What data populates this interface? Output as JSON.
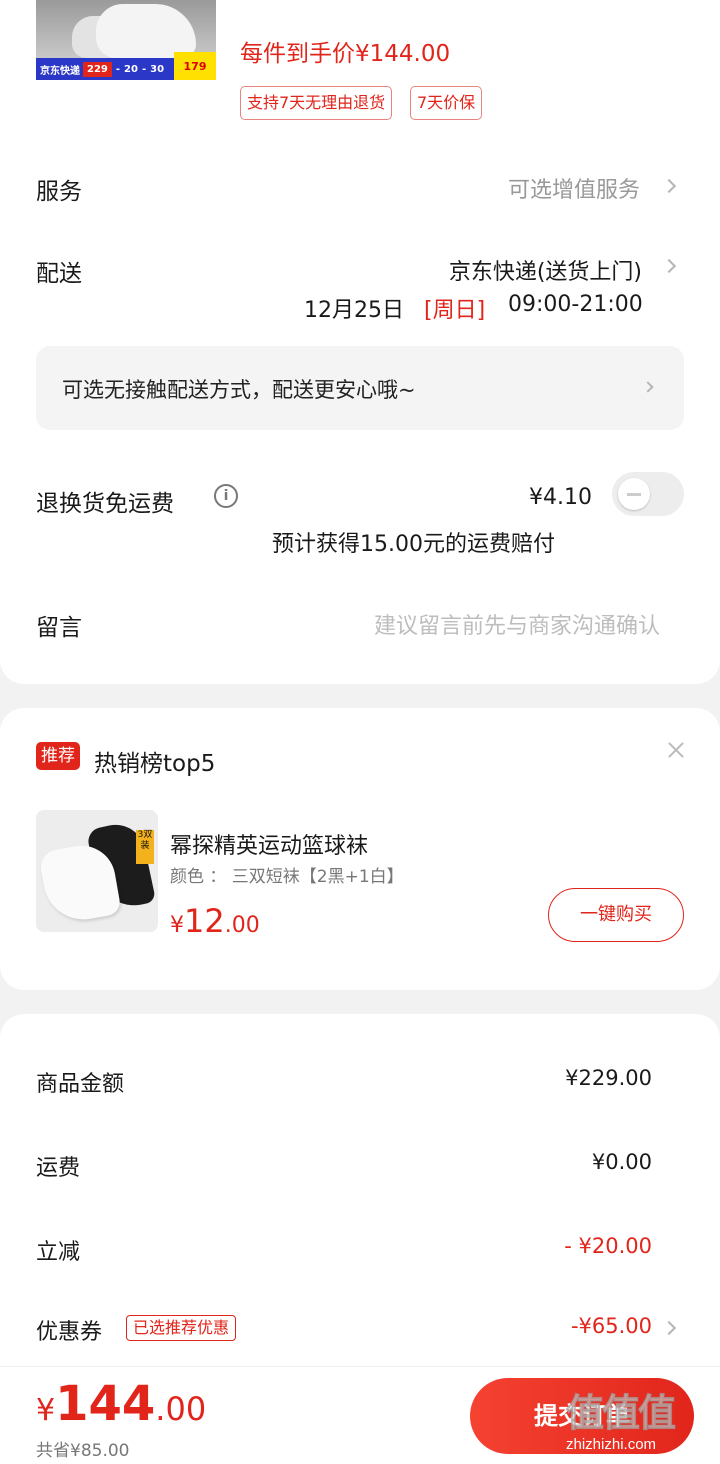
{
  "header_item": {
    "thumb_promo": [
      "京东快递",
      "229",
      "20",
      "30",
      "179"
    ],
    "unit_price": "每件到手价¥144.00",
    "tags": [
      "支持7天无理由退货",
      "7天价保"
    ]
  },
  "service": {
    "label": "服务",
    "value": "可选增值服务"
  },
  "delivery": {
    "label": "配送",
    "method": "京东快递(送货上门)",
    "date": "12月25日",
    "weekday": "[周日]",
    "time": "09:00-21:00"
  },
  "contactless_notice": "可选无接触配送方式，配送更安心哦~",
  "return_shipping": {
    "label": "退换货免运费",
    "info_icon": "info-icon",
    "price": "¥4.10",
    "note": "预计获得15.00元的运费赔付",
    "enabled": false
  },
  "message": {
    "label": "留言",
    "placeholder": "建议留言前先与商家沟通确认"
  },
  "recommend": {
    "badge": "推荐",
    "title": "热销榜top5",
    "product": {
      "name": "幂探精英运动篮球袜",
      "spec": "颜色 ： 三双短袜【2黑+1白】",
      "currency": "¥",
      "price_int": "12",
      "price_dec": ".00",
      "thumb_label": "3双装",
      "buy_label": "一键购买"
    }
  },
  "summary": {
    "goods_label": "商品金额",
    "goods_value": "¥229.00",
    "shipping_label": "运费",
    "shipping_value": "¥0.00",
    "discount_label": "立减",
    "discount_value": "- ¥20.00",
    "coupon_label": "优惠券",
    "coupon_tag": "已选推荐优惠",
    "coupon_value": "-¥65.00"
  },
  "footer": {
    "currency": "¥",
    "total_int": "144",
    "total_dec": ".00",
    "saved": "共省¥85.00",
    "submit_label": "提交订单",
    "watermark_logo": "值值值",
    "watermark_site": "zhizhizhi.com"
  },
  "colors": {
    "accent": "#e1251b",
    "muted": "#777777",
    "background": "#f2f2f2"
  }
}
